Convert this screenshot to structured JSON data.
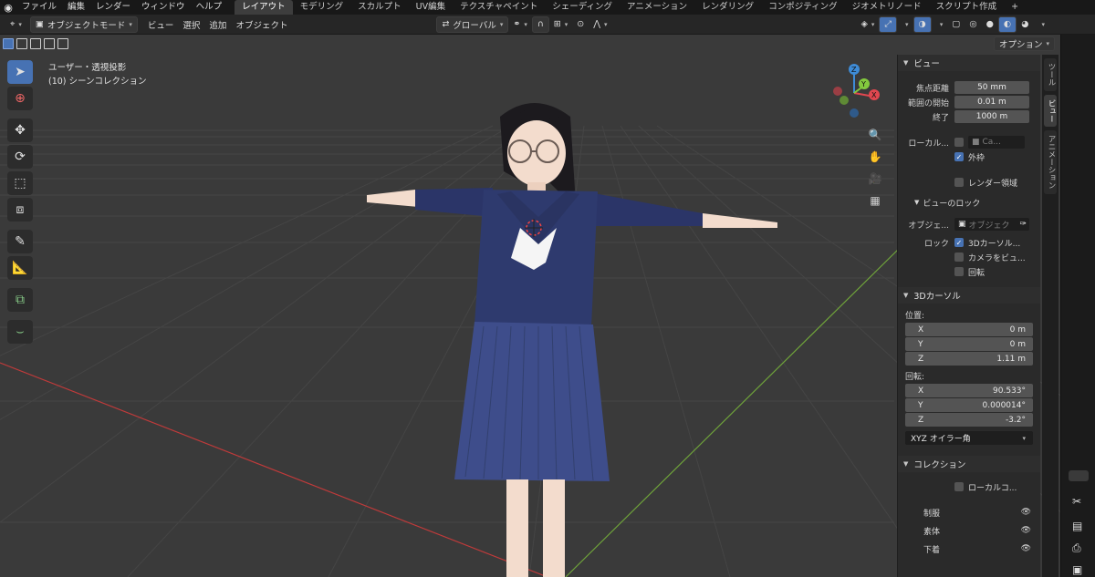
{
  "topbar": {
    "menus": [
      "ファイル",
      "編集",
      "レンダー",
      "ウィンドウ",
      "ヘルプ"
    ],
    "workspaces": [
      {
        "label": "レイアウト",
        "active": true
      },
      {
        "label": "モデリング",
        "active": false
      },
      {
        "label": "スカルプト",
        "active": false
      },
      {
        "label": "UV編集",
        "active": false
      },
      {
        "label": "テクスチャペイント",
        "active": false
      },
      {
        "label": "シェーディング",
        "active": false
      },
      {
        "label": "アニメーション",
        "active": false
      },
      {
        "label": "レンダリング",
        "active": false
      },
      {
        "label": "コンポジティング",
        "active": false
      },
      {
        "label": "ジオメトリノード",
        "active": false
      },
      {
        "label": "スクリプト作成",
        "active": false
      }
    ],
    "add_tab": "+"
  },
  "header": {
    "mode": "オブジェクトモード",
    "menus": [
      "ビュー",
      "選択",
      "追加",
      "オブジェクト"
    ],
    "orientation": "グローバル",
    "options": "オプション"
  },
  "viewport": {
    "view_label": "ユーザー・透視投影",
    "collection_label": "(10) シーンコレクション",
    "gizmo": {
      "x": "X",
      "y": "Y",
      "z": "Z"
    }
  },
  "sidebar": {
    "view": {
      "title": "ビュー",
      "focal_label": "焦点距離",
      "focal_value": "50 mm",
      "clip_start_label": "範囲の開始",
      "clip_start_value": "0.01 m",
      "clip_end_label": "終了",
      "clip_end_value": "1000 m",
      "local_camera_label": "ローカル...",
      "local_camera_value": "Ca...",
      "outline_label": "外枠",
      "render_region_label": "レンダー領域",
      "lock_section": "ビューのロック",
      "object_label": "オブジェ...",
      "object_placeholder": "オブジェク",
      "lock_label": "ロック",
      "lock_cursor": "3Dカーソル...",
      "lock_camera": "カメラをビュ...",
      "lock_rotation": "回転"
    },
    "cursor": {
      "title": "3Dカーソル",
      "location_label": "位置:",
      "loc_x_label": "X",
      "loc_x": "0 m",
      "loc_y_label": "Y",
      "loc_y": "0 m",
      "loc_z_label": "Z",
      "loc_z": "1.11 m",
      "rotation_label": "回転:",
      "rot_x_label": "X",
      "rot_x": "90.533°",
      "rot_y_label": "Y",
      "rot_y": "0.000014°",
      "rot_z_label": "Z",
      "rot_z": "-3.2°",
      "rotation_mode": "XYZ オイラー角"
    },
    "collection": {
      "title": "コレクション",
      "local_label": "ローカルコ...",
      "items": [
        "制服",
        "素体",
        "下着"
      ]
    },
    "tabs": [
      "ツール",
      "ビュー",
      "アニメーション"
    ]
  },
  "colors": {
    "accent": "#4772b3",
    "x_axis": "#e0474f",
    "y_axis": "#83c93e",
    "z_axis": "#3e8bd6"
  }
}
